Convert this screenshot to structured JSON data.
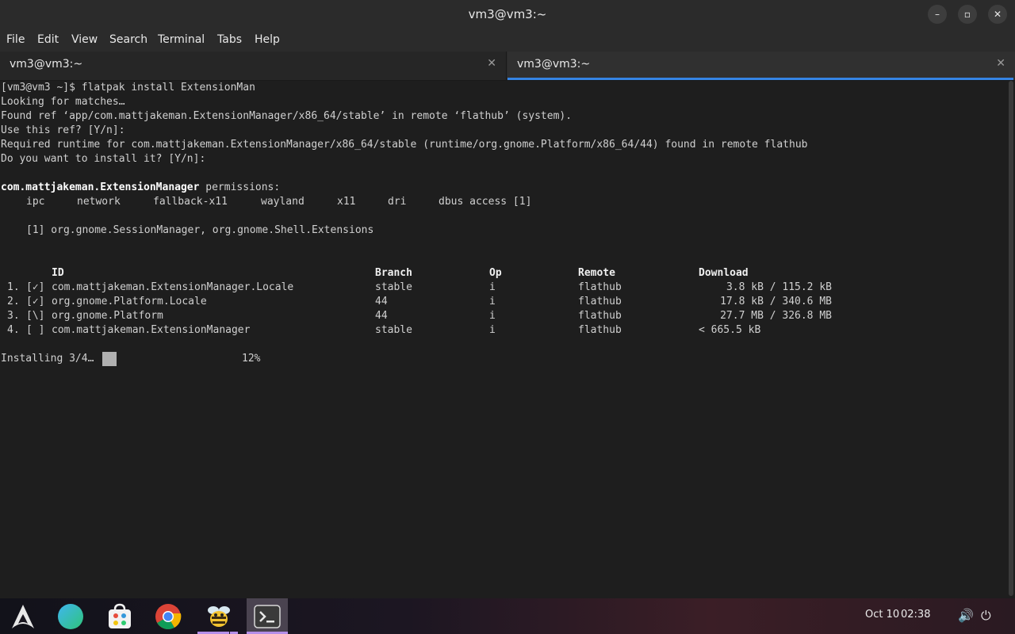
{
  "window": {
    "title": "vm3@vm3:~",
    "minimize_glyph": "–",
    "maximize_glyph": "▫",
    "close_glyph": "✕"
  },
  "menu": [
    "File",
    "Edit",
    "View",
    "Search",
    "Terminal",
    "Tabs",
    "Help"
  ],
  "tabs": [
    {
      "label": "vm3@vm3:~",
      "close_glyph": "✕"
    },
    {
      "label": "vm3@vm3:~",
      "close_glyph": "✕"
    }
  ],
  "terminal": {
    "lines": [
      "[vm3@vm3 ~]$ flatpak install ExtensionMan",
      "Looking for matches…",
      "Found ref ‘app/com.mattjakeman.ExtensionManager/x86_64/stable’ in remote ‘flathub’ (system).",
      "Use this ref? [Y/n]:",
      "Required runtime for com.mattjakeman.ExtensionManager/x86_64/stable (runtime/org.gnome.Platform/x86_64/44) found in remote flathub",
      "Do you want to install it? [Y/n]:"
    ],
    "perm_app": "com.mattjakeman.ExtensionManager",
    "perm_suffix": " permissions:",
    "permissions": [
      "ipc",
      "network",
      "fallback-x11",
      "wayland",
      "x11",
      "dri",
      "dbus access [1]"
    ],
    "footnote": "[1] org.gnome.SessionManager, org.gnome.Shell.Extensions",
    "table_headers": {
      "id": "ID",
      "branch": "Branch",
      "op": "Op",
      "remote": "Remote",
      "download": "Download"
    },
    "rows": [
      {
        "num": "1.",
        "status": "[✓]",
        "id": "com.mattjakeman.ExtensionManager.Locale",
        "branch": "stable",
        "op": "i",
        "remote": "flathub",
        "download": "3.8 kB / 115.2 kB"
      },
      {
        "num": "2.",
        "status": "[✓]",
        "id": "org.gnome.Platform.Locale",
        "branch": "44",
        "op": "i",
        "remote": "flathub",
        "download": "17.8 kB / 340.6 MB"
      },
      {
        "num": "3.",
        "status": "[\\]",
        "id": "org.gnome.Platform",
        "branch": "44",
        "op": "i",
        "remote": "flathub",
        "download": "27.7 MB / 326.8 MB"
      },
      {
        "num": "4.",
        "status": "[ ]",
        "id": "com.mattjakeman.ExtensionManager",
        "branch": "stable",
        "op": "i",
        "remote": "flathub",
        "download": "< 665.5 kB"
      }
    ],
    "installing_label": "Installing 3/4…",
    "progress_percent": "12%"
  },
  "taskbar": {
    "apps": [
      "arch-launcher-icon",
      "web-browser-globe-icon",
      "software-store-icon",
      "chrome-icon",
      "bee-app-icon",
      "terminal-icon"
    ],
    "date": "Oct 10",
    "time": "02:38",
    "volume_glyph": "🔊",
    "power_glyph": "⏻"
  }
}
